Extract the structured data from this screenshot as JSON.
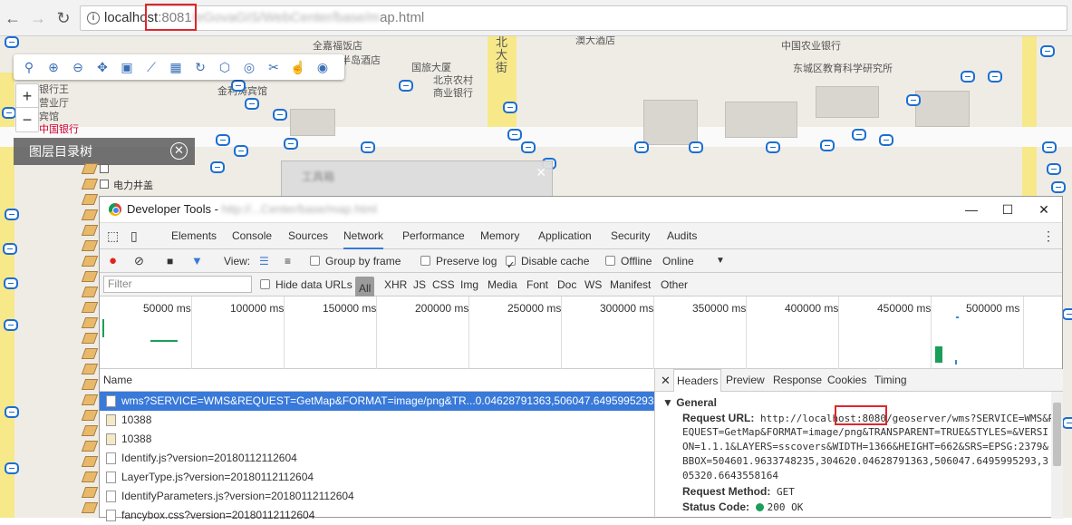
{
  "browser": {
    "url_host": "localhost",
    "url_port": ":8081",
    "url_path_visible_end": "ap.html",
    "back_icon": "back-arrow-icon",
    "forward_icon": "forward-arrow-icon",
    "reload_icon": "reload-icon"
  },
  "map": {
    "labels": [
      "全嘉福饭店",
      "北大街",
      "澳大酒店",
      "中国农业银行",
      "东城区教育科学研究所",
      "国旅大厦",
      "北京农村商业银行",
      "金利涛宾馆",
      "银行王",
      "营业厅",
      "宾馆",
      "中国银行",
      "时半岛酒店"
    ],
    "zoom_in": "+",
    "zoom_out": "−",
    "layer_panel_title": "图层目录树",
    "layer_items": [
      "电力井盖"
    ],
    "popup_close": "✕"
  },
  "devtools": {
    "title": "Developer Tools - ",
    "title_blurred": "http://...Center/base/map.html",
    "tabs": [
      "Elements",
      "Console",
      "Sources",
      "Network",
      "Performance",
      "Memory",
      "Application",
      "Security",
      "Audits"
    ],
    "active_tab": "Network",
    "toolbar": {
      "view_label": "View:",
      "group_by_frame": "Group by frame",
      "preserve_log": "Preserve log",
      "disable_cache": "Disable cache",
      "offline": "Offline",
      "online": "Online"
    },
    "filter": {
      "placeholder": "Filter",
      "hide_data_urls": "Hide data URLs",
      "types": [
        "All",
        "XHR",
        "JS",
        "CSS",
        "Img",
        "Media",
        "Font",
        "Doc",
        "WS",
        "Manifest",
        "Other"
      ]
    },
    "timeline_ticks": [
      "50000 ms",
      "100000 ms",
      "150000 ms",
      "200000 ms",
      "250000 ms",
      "300000 ms",
      "350000 ms",
      "400000 ms",
      "450000 ms",
      "500000 ms"
    ],
    "requests_header": "Name",
    "requests": [
      "wms?SERVICE=WMS&REQUEST=GetMap&FORMAT=image/png&TR...0.04628791363,506047.6495995293,3",
      "10388",
      "10388",
      "Identify.js?version=20180112112604",
      "LayerType.js?version=20180112112604",
      "IdentifyParameters.js?version=20180112112604",
      "fancybox.css?version=20180112112604"
    ],
    "detail_tabs": [
      "Headers",
      "Preview",
      "Response",
      "Cookies",
      "Timing"
    ],
    "general_title": "▼ General",
    "request_url_label": "Request URL:",
    "request_url_line1_pre": "http://localhost",
    "request_url_port": ":8080",
    "request_url_line1_post": "/geoserver/wms?SERVICE=WMS&R",
    "request_url_lines": [
      "EQUEST=GetMap&FORMAT=image/png&TRANSPARENT=TRUE&STYLES=&VERSI",
      "ON=1.1.1&LAYERS=sscovers&WIDTH=1366&HEIGHT=662&SRS=EPSG:2379&",
      "BBOX=504601.9633748235,304620.04628791363,506047.6495995293,3",
      "05320.6643558164"
    ],
    "request_method_label": "Request Method:",
    "request_method": "GET",
    "status_code_label": "Status Code:",
    "status_code": "200 OK"
  }
}
